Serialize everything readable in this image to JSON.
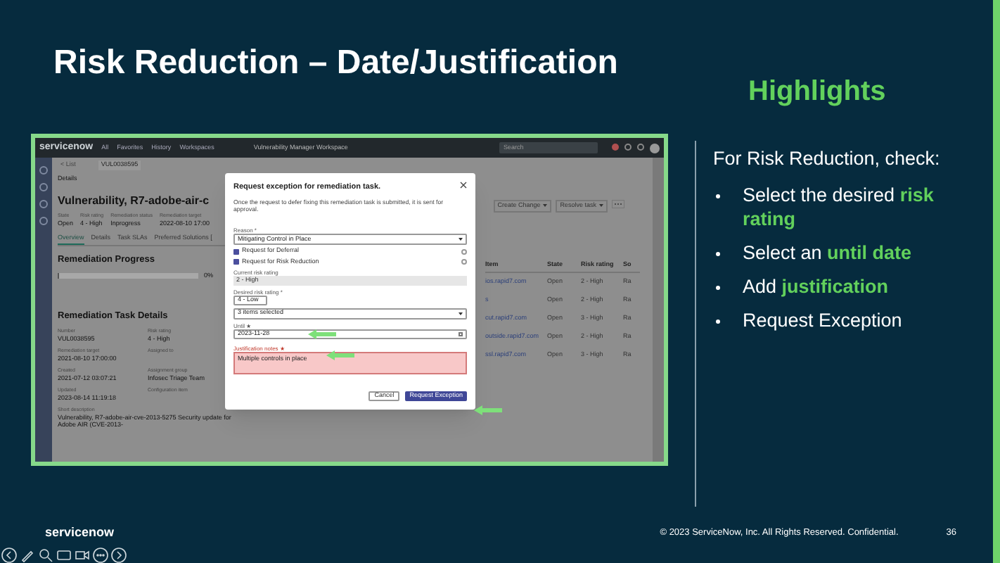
{
  "slide": {
    "title": "Risk Reduction – Date/Justification",
    "logo": "servicenow",
    "copyright": "© 2023 ServiceNow, Inc. All Rights Reserved. Confidential.",
    "page_number": "36"
  },
  "highlights": {
    "heading": "Highlights",
    "intro": "For Risk Reduction, check:",
    "bullets": [
      "Select the desired **risk rating**",
      "Select an **until date**",
      "Add **justification**",
      "Request Exception"
    ]
  },
  "app": {
    "brand": "servicenow",
    "nav": [
      "All",
      "Favorites",
      "History",
      "Workspaces"
    ],
    "workspace": "Vulnerability Manager Workspace",
    "search": {
      "placeholder": "Search"
    },
    "record_tabs": [
      {
        "label": "< List",
        "selected": false
      },
      {
        "label": "VUL0038595",
        "selected": true
      }
    ],
    "section": "Details",
    "heading": "Vulnerability, R7-adobe-air-c",
    "summary": [
      {
        "label": "State",
        "value": "Open"
      },
      {
        "label": "Risk rating",
        "value": "4 - High"
      },
      {
        "label": "Remediation status",
        "value": "Inprogress"
      },
      {
        "label": "Remediation target",
        "value": "2022-08-10 17:00"
      }
    ],
    "detail_tabs": [
      {
        "label": "Overview",
        "selected": true
      },
      {
        "label": "Details",
        "selected": false
      },
      {
        "label": "Task SLAs",
        "selected": false
      },
      {
        "label": "Preferred Solutions [",
        "selected": false
      }
    ],
    "progress": {
      "title": "Remediation Progress",
      "level": 0.01,
      "reading": "0%"
    },
    "task_details": {
      "title": "Remediation Task Details",
      "fields": [
        {
          "label": "Number",
          "value": "VUL0038595"
        },
        {
          "label": "Risk rating",
          "value": "4 - High"
        },
        {
          "label": "Remediation target",
          "value": "2021-08-10 17:00:00"
        },
        {
          "label": "Assigned to"
        },
        {
          "label": "Created",
          "value": "2021-07-12 03:07:21"
        },
        {
          "label": "Assignment group",
          "value": "Infosec Triage Team"
        },
        {
          "label": "Updated",
          "value": "2023-08-14 11:19:18"
        },
        {
          "label": "Configuration item"
        }
      ],
      "short_description": {
        "label": "Short description",
        "value": "Vulnerability, R7-adobe-air-cve-2013-5275 Security update for Adobe AIR (CVE-2013-"
      }
    },
    "actions": [
      "Create Change",
      "Resolve task"
    ],
    "table": {
      "columns": [
        "Item",
        "State",
        "Risk rating",
        "So"
      ],
      "rows": [
        [
          "ios.rapid7.com",
          "Open",
          "2 - High",
          "Ra"
        ],
        [
          "s",
          "Open",
          "2 - High",
          "Ra"
        ],
        [
          "cut.rapid7.com",
          "Open",
          "3 - High",
          "Ra"
        ],
        [
          "outside.rapid7.com",
          "Open",
          "2 - High",
          "Ra"
        ],
        [
          "ssl.rapid7.com",
          "Open",
          "3 - High",
          "Ra"
        ]
      ]
    }
  },
  "dialog": {
    "title": "Request exception for remediation task.",
    "description": "Once the request to defer fixing this remediation task is submitted, it is sent for approval.",
    "fields": [
      {
        "kind": "select",
        "label": "Reason *",
        "value": "Mitigating Control in Place"
      },
      {
        "kind": "checkbox",
        "label": "Request for Deferral",
        "checked": true
      },
      {
        "kind": "checkbox",
        "label": "Request for Risk Reduction",
        "checked": true
      },
      {
        "kind": "readonly",
        "label": "Current risk rating",
        "value": "2 - High"
      },
      {
        "kind": "small_select",
        "label": "Desired risk rating *",
        "value": "4 - Low"
      },
      {
        "kind": "select",
        "value": "3 items selected"
      },
      {
        "kind": "date",
        "label": "Until ★",
        "value": "2023-11-28"
      },
      {
        "kind": "textarea",
        "label": "Justification notes ★",
        "value": "Multiple controls in place"
      }
    ],
    "buttons": [
      {
        "label": "Cancel",
        "primary": false
      },
      {
        "label": "Request Exception",
        "primary": true
      }
    ]
  }
}
